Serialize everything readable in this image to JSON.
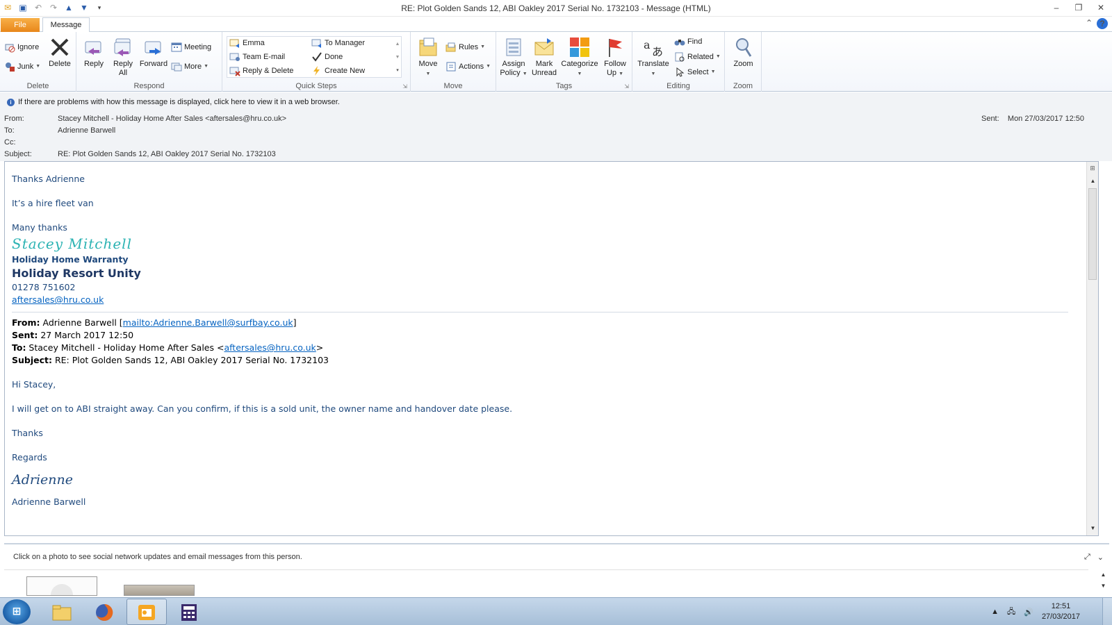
{
  "window": {
    "title": "RE: Plot Golden Sands 12, ABI Oakley 2017 Serial No. 1732103  -  Message (HTML)"
  },
  "tabs": {
    "file": "File",
    "message": "Message"
  },
  "ribbon": {
    "delete_group": {
      "label": "Delete",
      "ignore": "Ignore",
      "junk": "Junk",
      "delete": "Delete"
    },
    "respond_group": {
      "label": "Respond",
      "reply": "Reply",
      "reply_all_1": "Reply",
      "reply_all_2": "All",
      "forward": "Forward",
      "meeting": "Meeting",
      "more": "More"
    },
    "quicksteps_group": {
      "label": "Quick Steps",
      "emma": "Emma",
      "team_email": "Team E-mail",
      "reply_delete": "Reply & Delete",
      "to_manager": "To Manager",
      "done": "Done",
      "create_new": "Create New"
    },
    "move_group": {
      "label": "Move",
      "move": "Move",
      "rules": "Rules",
      "actions": "Actions"
    },
    "tags_group": {
      "label": "Tags",
      "assign_1": "Assign",
      "assign_2": "Policy",
      "mark_1": "Mark",
      "mark_2": "Unread",
      "categorize": "Categorize",
      "follow_1": "Follow",
      "follow_2": "Up"
    },
    "editing_group": {
      "label": "Editing",
      "translate": "Translate",
      "find": "Find",
      "related": "Related",
      "select": "Select"
    },
    "zoom_group": {
      "label": "Zoom",
      "zoom": "Zoom"
    }
  },
  "header": {
    "infobar": "If there are problems with how this message is displayed, click here to view it in a web browser.",
    "from_label": "From:",
    "from_value": "Stacey Mitchell - Holiday Home After Sales <aftersales@hru.co.uk>",
    "to_label": "To:",
    "to_value": "Adrienne Barwell",
    "cc_label": "Cc:",
    "subject_label": "Subject:",
    "subject_value": "RE: Plot Golden Sands 12, ABI Oakley 2017 Serial No. 1732103",
    "sent_label": "Sent:",
    "sent_value": "Mon 27/03/2017 12:50"
  },
  "body": {
    "greeting": "Thanks Adrienne",
    "line1": "It’s a hire fleet van",
    "closing": "Many thanks",
    "signature_name": "Stacey Mitchell",
    "sig_dept": "Holiday Home Warranty",
    "sig_company": "Holiday Resort Unity",
    "sig_phone": "01278 751602",
    "sig_email": "aftersales@hru.co.uk",
    "quoted": {
      "from_label": "From:",
      "from_name": " Adrienne Barwell [",
      "from_link": "mailto:Adrienne.Barwell@surfbay.co.uk",
      "from_end": "]",
      "sent_label": "Sent:",
      "sent_value": " 27 March 2017 12:50",
      "to_label": "To:",
      "to_name": " Stacey Mitchell - Holiday Home After Sales <",
      "to_link": "aftersales@hru.co.uk",
      "to_end": ">",
      "subject_label": "Subject:",
      "subject_value": " RE: Plot Golden Sands 12, ABI Oakley 2017 Serial No. 1732103"
    },
    "q_greeting": "Hi Stacey,",
    "q_line1": "I will get on to ABI straight away.  Can you confirm, if this is a sold unit, the owner name and handover date please.",
    "q_thanks": "Thanks",
    "q_regards": "Regards",
    "q_signature": "Adrienne",
    "q_name": "Adrienne Barwell"
  },
  "people_pane": {
    "text": "Click on a photo to see social network updates and email messages from this person."
  },
  "taskbar": {
    "time": "12:51",
    "date": "27/03/2017"
  }
}
